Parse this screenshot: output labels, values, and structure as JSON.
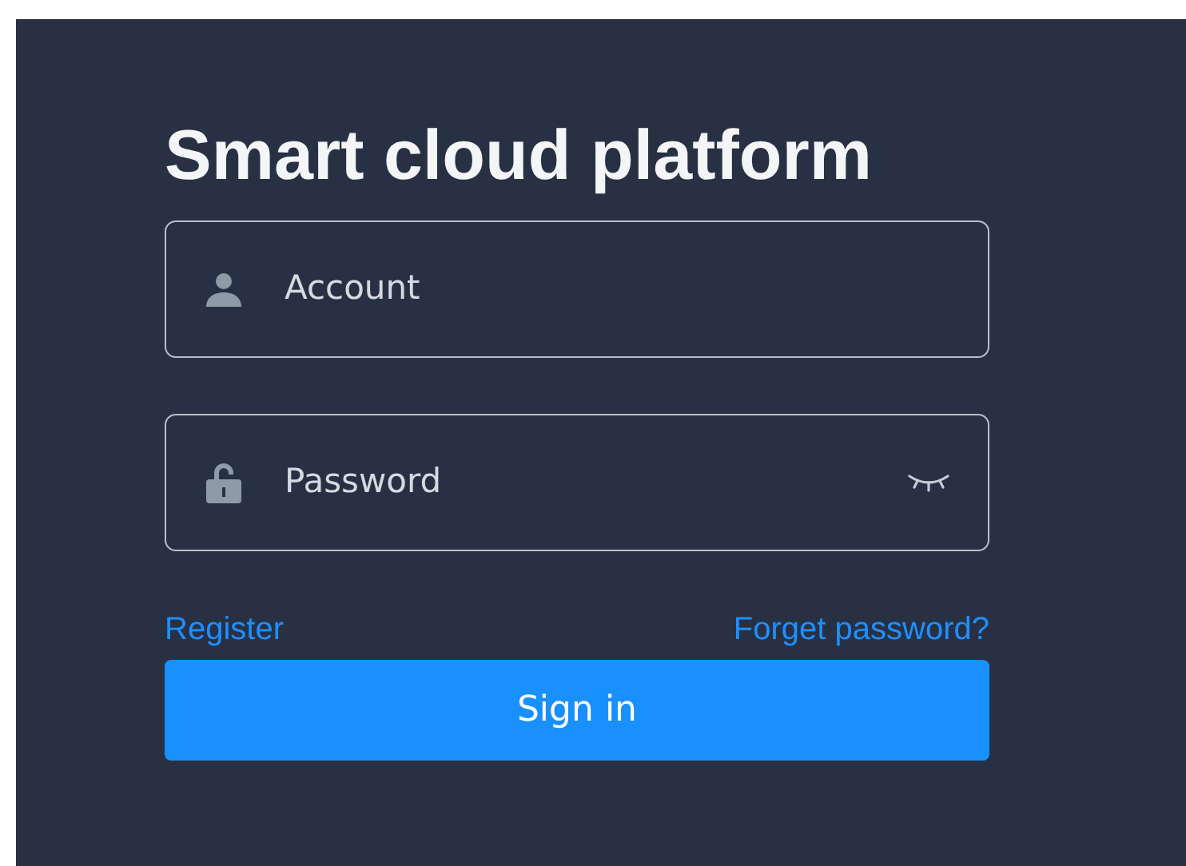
{
  "title": "Smart cloud platform",
  "fields": [
    {
      "kind": "account",
      "placeholder": "Account"
    },
    {
      "kind": "password",
      "placeholder": "Password"
    }
  ],
  "links": [
    "Register",
    "Forget password?"
  ],
  "button": "Sign in"
}
